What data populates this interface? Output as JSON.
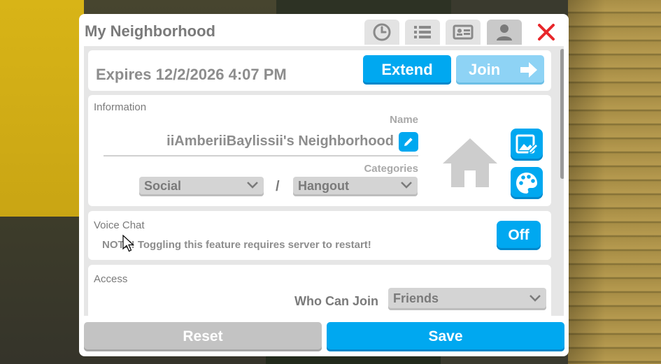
{
  "window": {
    "title": "My Neighborhood",
    "tabs": [
      {
        "icon": "clock-icon"
      },
      {
        "icon": "list-icon"
      },
      {
        "icon": "id-card-icon"
      },
      {
        "icon": "person-icon",
        "active": true
      }
    ],
    "close_icon": "close-icon"
  },
  "status": {
    "expires_text": "Expires 12/2/2026 4:07 PM",
    "extend_label": "Extend",
    "join_label": "Join"
  },
  "information": {
    "section_label": "Information",
    "name_label": "Name",
    "name_value": "iiAmberiiBaylissii's Neighborhood",
    "categories_label": "Categories",
    "category_1": "Social",
    "separator": "/",
    "category_2": "Hangout"
  },
  "voice_chat": {
    "section_label": "Voice Chat",
    "note": "NOTE! Toggling this feature requires server to restart!",
    "toggle_label": "Off"
  },
  "access": {
    "section_label": "Access",
    "who_can_join_label": "Who Can Join",
    "who_can_join_value": "Friends"
  },
  "footer": {
    "reset_label": "Reset",
    "save_label": "Save"
  },
  "colors": {
    "accent": "#00a8f0",
    "close": "#e8272b",
    "disabled_join": "#8ed3f5"
  }
}
